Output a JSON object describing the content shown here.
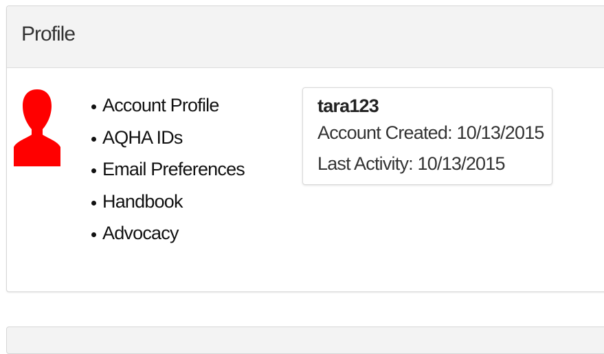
{
  "panel": {
    "title": "Profile"
  },
  "avatar": {
    "icon": "user-silhouette-icon",
    "color": "#ff0000"
  },
  "nav": {
    "items": [
      {
        "label": "Account Profile"
      },
      {
        "label": "AQHA IDs"
      },
      {
        "label": "Email Preferences"
      },
      {
        "label": "Handbook"
      },
      {
        "label": "Advocacy"
      }
    ]
  },
  "account": {
    "username": "tara123",
    "created": "Account Created: 10/13/2015",
    "last_activity": "Last Activity: 10/13/2015"
  }
}
